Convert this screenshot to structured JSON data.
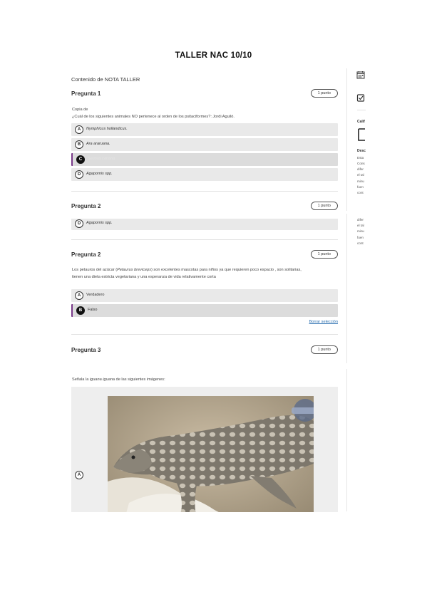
{
  "page": {
    "title": "TALLER NAC 10/10"
  },
  "content_heading": "Contenido de NOTA TALLER",
  "q1": {
    "title": "Pregunta 1",
    "points": "1 punto",
    "text_line1": "Copia de",
    "text_line2": "¿Cuál de los siguientes animales NO pertenece al orden de los psitaciformes?: Jordi Aguiló.",
    "options": [
      {
        "letter": "A",
        "text": "Nymphicus hollandicus."
      },
      {
        "letter": "B",
        "text": "Ara araruana."
      },
      {
        "letter": "C",
        "text": "Serinus canaria.",
        "selected": true
      },
      {
        "letter": "D",
        "text": "Agapornis spp."
      }
    ]
  },
  "q2_partial": {
    "title": "Pregunta 2",
    "points": "1 punto",
    "option": {
      "letter": "D",
      "text": "Agapornis spp."
    }
  },
  "q2": {
    "title": "Pregunta 2",
    "points": "1 punto",
    "text_a": "Los petauros del azúcar (",
    "text_b": "Petaurus breviceps",
    "text_c": ") son excelentes mascotas para niños ya que requieren poco espacio , son solitarias,",
    "text_line2": "tienen una dieta estricta vegetariana y una esperanza de vida relativamente corta",
    "options": [
      {
        "letter": "A",
        "text": "Verdadero"
      },
      {
        "letter": "B",
        "text": "Falso",
        "selected": true
      }
    ],
    "clear_label": "Borrar selección"
  },
  "q3": {
    "title": "Pregunta 3",
    "points": "1 punto",
    "text_a": "Señala la ",
    "text_b": "iguana iguana",
    "text_c": "  de las siguientes imágenes:",
    "option_letter": "A"
  },
  "sidebar": {
    "calendar_icon": "calendar-icon",
    "check_icon": "check-icon",
    "grade_label": "Calif",
    "desc_label": "Desc",
    "desc_lines": [
      "Esta",
      "Cons",
      "difer",
      "el tal",
      "minu",
      "fuen",
      "cont"
    ],
    "desc_lines_2": [
      "difer",
      "el tal",
      "minu",
      "fuen",
      "cont"
    ]
  }
}
